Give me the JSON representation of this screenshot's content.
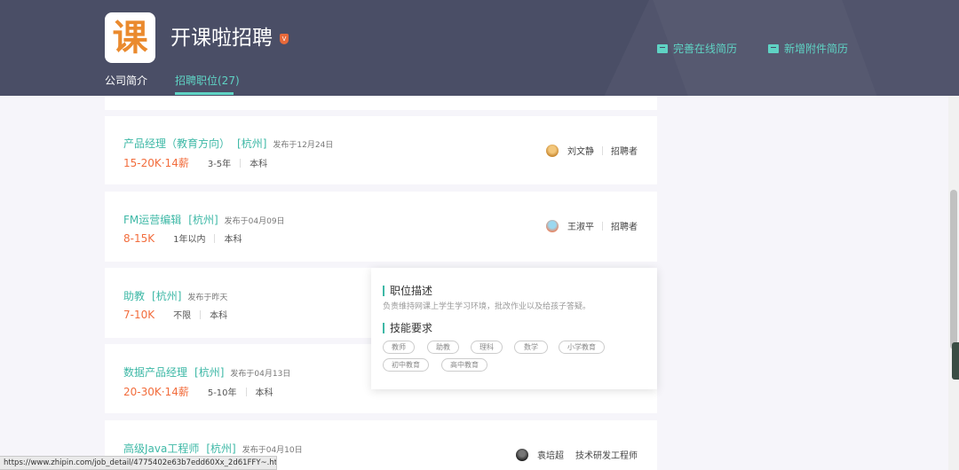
{
  "header": {
    "logo_glyph": "课",
    "company_name": "开课啦招聘",
    "badge_text": "V",
    "actions": [
      {
        "label": "完善在线简历",
        "icon": "resume-icon"
      },
      {
        "label": "新增附件简历",
        "icon": "attachment-icon"
      }
    ],
    "tabs": [
      {
        "label": "公司简介",
        "active": false
      },
      {
        "label": "招聘职位(27)",
        "active": true
      }
    ]
  },
  "jobs": [
    {
      "title": "产品经理（教育方向）",
      "city": "[杭州]",
      "date": "发布于12月24日",
      "salary": "15-20K·14薪",
      "experience": "3-5年",
      "education": "本科",
      "recruiter_name": "刘文静",
      "recruiter_role": "招聘者"
    },
    {
      "title": "FM运营编辑",
      "city": "[杭州]",
      "date": "发布于04月09日",
      "salary": "8-15K",
      "experience": "1年以内",
      "education": "本科",
      "recruiter_name": "王淑平",
      "recruiter_role": "招聘者"
    },
    {
      "title": "助教",
      "city": "[杭州]",
      "date": "发布于昨天",
      "salary": "7-10K",
      "experience": "不限",
      "education": "本科"
    },
    {
      "title": "数据产品经理",
      "city": "[杭州]",
      "date": "发布于04月13日",
      "salary": "20-30K·14薪",
      "experience": "5-10年",
      "education": "本科"
    },
    {
      "title": "高级Java工程师",
      "city": "[杭州]",
      "date": "发布于04月10日",
      "recruiter_name": "袁培超",
      "recruiter_role": "技术研发工程师"
    }
  ],
  "popup": {
    "desc_heading": "职位描述",
    "desc_text": "负责维持网课上学生学习环境，批改作业以及给孩子答疑。",
    "skills_heading": "技能要求",
    "skills": [
      "教师",
      "助教",
      "理科",
      "数学",
      "小学教育",
      "初中教育",
      "高中教育"
    ]
  },
  "statusbar": {
    "url": "https://www.zhipin.com/job_detail/4775402e63b7edd60Xx_2d61FFY~.html"
  },
  "colors": {
    "header_bg": "#4a4e66",
    "accent": "#3db8a6",
    "salary": "#f26d3d"
  }
}
